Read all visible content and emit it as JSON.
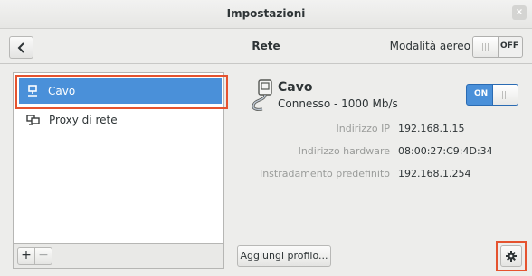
{
  "window": {
    "title": "Impostazioni",
    "close_glyph": "×"
  },
  "header": {
    "title": "Rete",
    "airplane_mode_label": "Modalità aereo",
    "airplane_mode_state": "OFF"
  },
  "sidebar": {
    "items": [
      {
        "label": "Cavo",
        "icon": "wired-network-icon",
        "selected": true
      },
      {
        "label": "Proxy di rete",
        "icon": "network-proxy-icon",
        "selected": false
      }
    ],
    "add_label": "+",
    "remove_label": "−"
  },
  "device": {
    "name": "Cavo",
    "status": "Connesso - 1000 Mb/s",
    "switch_state": "ON",
    "details": [
      {
        "label": "Indirizzo IP",
        "value": "192.168.1.15"
      },
      {
        "label": "Indirizzo hardware",
        "value": "08:00:27:C9:4D:34"
      },
      {
        "label": "Instradamento predefinito",
        "value": "192.168.1.254"
      }
    ]
  },
  "footer": {
    "add_profile_label": "Aggiungi profilo..."
  },
  "colors": {
    "accent": "#4a90d9",
    "highlight": "#e5532f"
  }
}
